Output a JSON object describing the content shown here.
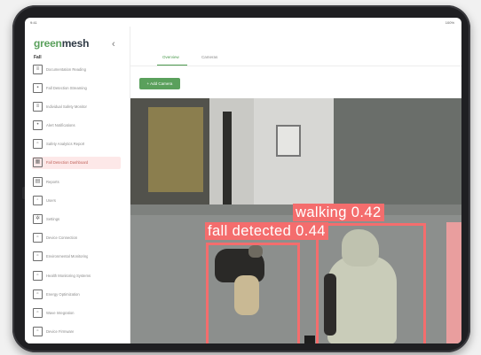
{
  "colors": {
    "accent": "#5aa05c",
    "bbox": "#f46d6d",
    "active_nav_bg": "#fde8e8"
  },
  "statusbar": {
    "time": "9:41",
    "battery": "100%"
  },
  "brand": {
    "part1": "green",
    "part2": "mesh"
  },
  "sidebar": {
    "collapse_icon": "chevron-left-icon",
    "section_label": "Fall",
    "items": [
      {
        "label": "Documentation Reading",
        "icon": "document-icon"
      },
      {
        "label": "Fall Detection Streaming",
        "icon": "camera-icon"
      },
      {
        "label": "Individual Safety Monitor",
        "icon": "list-icon"
      },
      {
        "label": "Alert Notifications",
        "icon": "bell-icon"
      },
      {
        "label": "Safety Analytics Report",
        "icon": "chart-icon"
      },
      {
        "label": "Fall Detection Dashboard",
        "icon": "dashboard-icon",
        "active": true
      },
      {
        "label": "Reports",
        "icon": "report-icon"
      },
      {
        "label": "Users",
        "icon": "user-icon"
      },
      {
        "label": "Settings",
        "icon": "gear-icon"
      },
      {
        "label": "Device Connection",
        "icon": "device-icon"
      },
      {
        "label": "Environmental Monitoring",
        "icon": "leaf-icon"
      },
      {
        "label": "Health Monitoring Systems",
        "icon": "heart-icon"
      },
      {
        "label": "Energy Optimization",
        "icon": "bolt-icon"
      },
      {
        "label": "Wave Integration",
        "icon": "wave-icon"
      },
      {
        "label": "Device Firmware",
        "icon": "chip-icon"
      }
    ]
  },
  "main": {
    "tabs": [
      {
        "label": "Overview",
        "active": true
      },
      {
        "label": "Cameras",
        "active": false
      }
    ],
    "primary_button": "+ Add Camera"
  },
  "detections": [
    {
      "label": "walking 0.42"
    },
    {
      "label": "fall detected 0.44"
    }
  ]
}
